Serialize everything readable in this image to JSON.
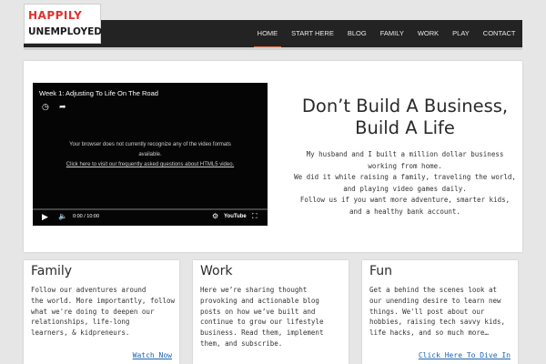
{
  "logo": {
    "line1": "HAPPILY",
    "line2": "UNEMPLOYED"
  },
  "nav": {
    "items": [
      "HOME",
      "START HERE",
      "BLOG",
      "FAMILY",
      "WORK",
      "PLAY",
      "CONTACT"
    ],
    "active": "HOME",
    "active_color": "#e8744a"
  },
  "video": {
    "title": "Week 1: Adjusting To Life On The Road",
    "message_line1": "Your browser does not currently recognize any of the video formats",
    "message_line2": "available.",
    "link": "Click here to visit our frequently asked questions about HTML5 video.",
    "time": "0:00 / 10:00",
    "brand": "YouTube",
    "icons": [
      "clock-icon",
      "share-icon",
      "play-icon",
      "volume-icon",
      "gear-icon",
      "fullscreen-icon"
    ]
  },
  "hero": {
    "headline_line1": "Don’t Build A Business,",
    "headline_line2": "Build A Life",
    "lines": [
      "My husband and I built a million dollar business",
      "working from home.",
      "We did it while raising a family, traveling the world,",
      "and playing video games daily.",
      "Follow us if you want more adventure, smarter kids,",
      "and a healthy bank account."
    ]
  },
  "cards": [
    {
      "title": "Family",
      "lines": [
        "Follow our adventures around",
        "the world. More importantly, follow",
        "what we're doing to deepen our",
        "relationships, life-long",
        "learners, & kidpreneurs."
      ],
      "cta": "Watch Now"
    },
    {
      "title": "Work",
      "lines": [
        "Here we’re sharing thought",
        "provoking and actionable blog",
        "posts on how we’ve built and",
        "continue to grow our lifestyle",
        "business.  Read them, implement",
        "them, and subscribe."
      ],
      "cta": ""
    },
    {
      "title": "Fun",
      "lines": [
        "Get a behind the scenes look at",
        "our unending desire to learn new",
        "things. We'll post about our",
        "hobbies, raising tech savvy kids,",
        "life hacks, and so much more…"
      ],
      "cta": "Click Here To Dive In"
    }
  ]
}
